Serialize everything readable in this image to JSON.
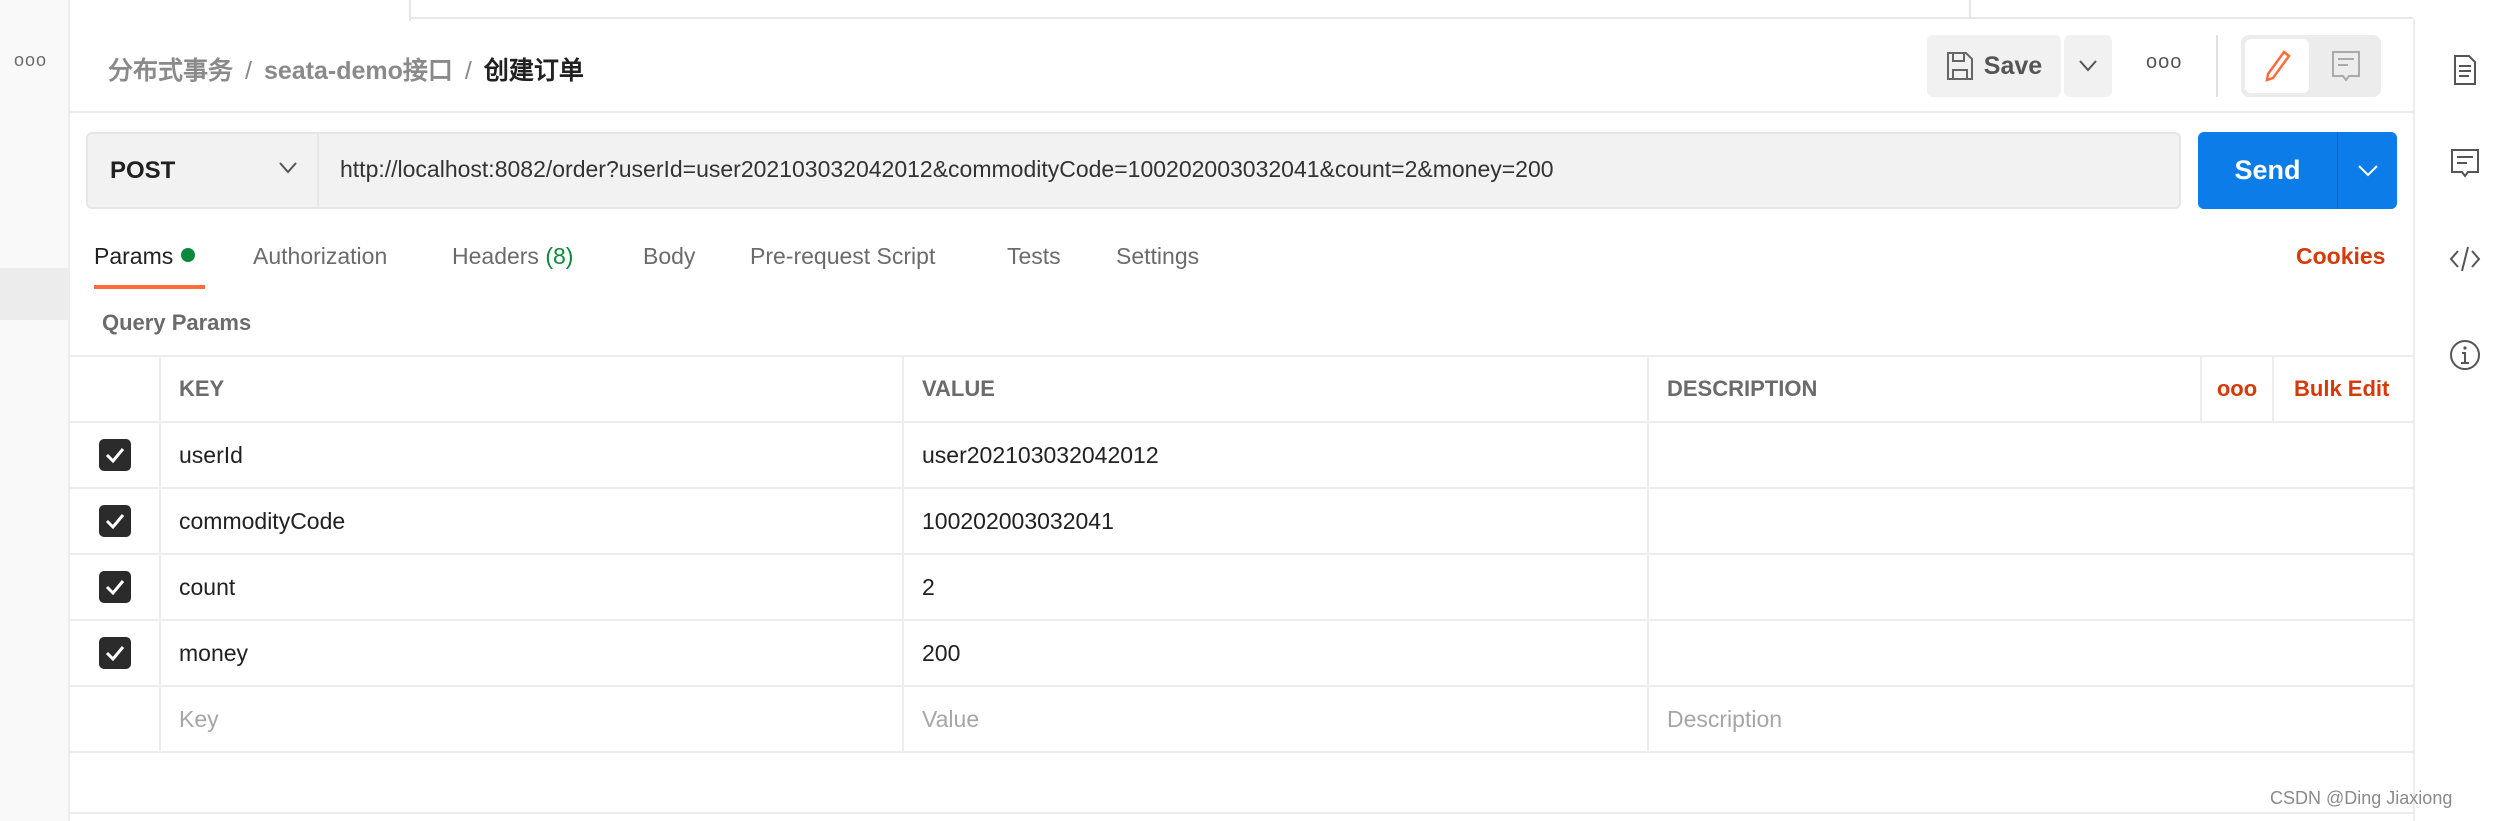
{
  "header": {
    "breadcrumb": [
      "分布式事务",
      "seata-demo接口",
      "创建订单"
    ],
    "separator": "/",
    "save_label": "Save",
    "more_label": "ooo"
  },
  "sidebar": {
    "more_label": "ooo"
  },
  "request": {
    "method": "POST",
    "url": "http://localhost:8082/order?userId=user202103032042012&commodityCode=100202003032041&count=2&money=200",
    "send_label": "Send"
  },
  "tabs": [
    {
      "label": "Params",
      "active": true
    },
    {
      "label": "Authorization"
    },
    {
      "label": "Headers",
      "count": "(8)"
    },
    {
      "label": "Body"
    },
    {
      "label": "Pre-request Script"
    },
    {
      "label": "Tests"
    },
    {
      "label": "Settings"
    }
  ],
  "cookies_label": "Cookies",
  "query_params": {
    "title": "Query Params",
    "columns": {
      "key": "KEY",
      "value": "VALUE",
      "description": "DESCRIPTION",
      "more": "ooo",
      "bulk_edit": "Bulk Edit"
    },
    "rows": [
      {
        "checked": true,
        "key": "userId",
        "value": "user202103032042012",
        "description": ""
      },
      {
        "checked": true,
        "key": "commodityCode",
        "value": "100202003032041",
        "description": ""
      },
      {
        "checked": true,
        "key": "count",
        "value": "2",
        "description": ""
      },
      {
        "checked": true,
        "key": "money",
        "value": "200",
        "description": ""
      }
    ],
    "placeholders": {
      "key": "Key",
      "value": "Value",
      "description": "Description"
    }
  },
  "watermark": "CSDN @Ding Jiaxiong",
  "colors": {
    "accent": "#ff6c37",
    "send": "#0c7ce9",
    "link": "#d63a0a",
    "green": "#0a8a3a"
  }
}
